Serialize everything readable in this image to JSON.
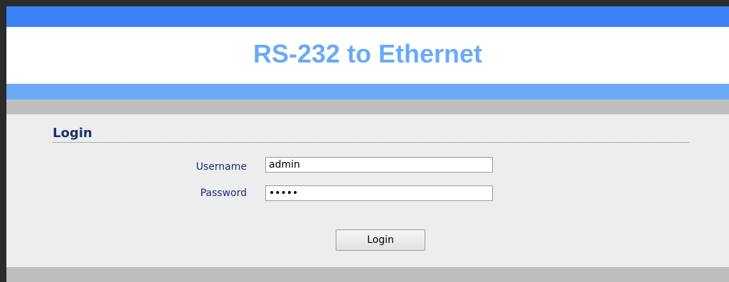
{
  "header": {
    "title": "RS-232 to Ethernet"
  },
  "login": {
    "section_title": "Login",
    "username_label": "Username",
    "username_value": "admin",
    "password_label": "Password",
    "password_value": "admin",
    "button_label": "Login"
  },
  "colors": {
    "top_bar": "#3b82f6",
    "title_text": "#6aaaf6",
    "accent_bar": "#6aaaf6",
    "gray_bar": "#bebebe",
    "label_text": "#1e2f6e"
  }
}
